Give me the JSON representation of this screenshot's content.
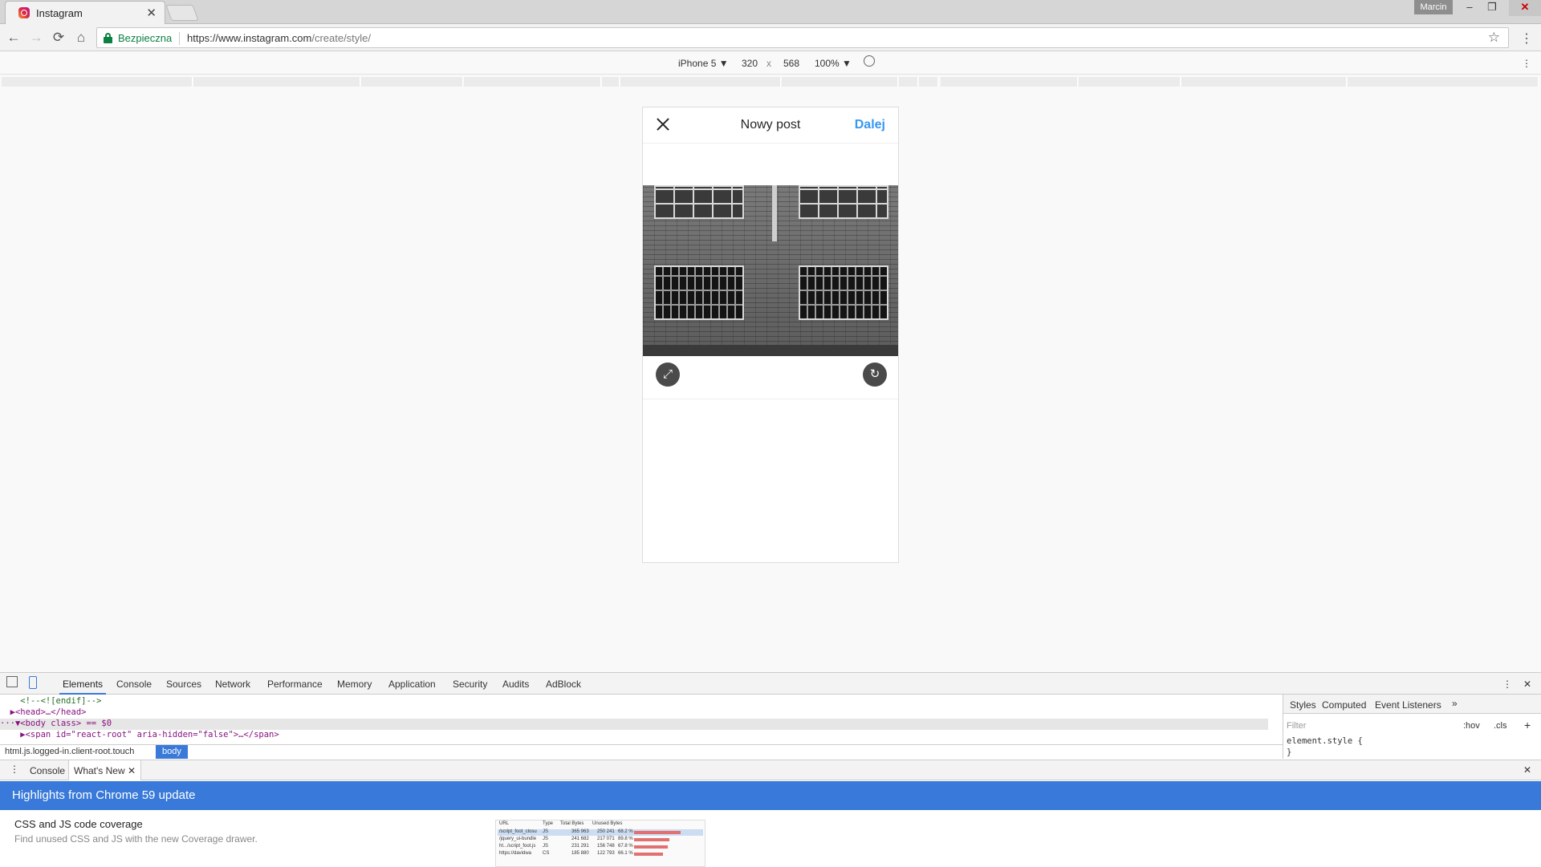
{
  "browser": {
    "tab_title": "Instagram",
    "tab_close": "✕",
    "user_name": "Marcin",
    "win_minimize": "–",
    "win_restore": "❐",
    "win_close": "✕",
    "secure_label": "Bezpieczna",
    "url_host": "https://www.instagram.com",
    "url_path": "/create/style/",
    "back_glyph": "←",
    "forward_glyph": "→",
    "reload_glyph": "⟳",
    "home_glyph": "⌂",
    "star_glyph": "☆",
    "menu_glyph": "⋮"
  },
  "device_toolbar": {
    "device": "iPhone 5 ▼",
    "width": "320",
    "times": "x",
    "height": "568",
    "zoom": "100% ▼",
    "rotate_glyph": "⃠",
    "more_glyph": "⋮"
  },
  "post": {
    "title": "Nowy post",
    "next_label": "Dalej",
    "expand_glyph": "⤢",
    "rotate_glyph": "↻"
  },
  "devtools": {
    "tabs": [
      "Elements",
      "Console",
      "Sources",
      "Network",
      "Performance",
      "Memory",
      "Application",
      "Security",
      "Audits",
      "AdBlock"
    ],
    "code": [
      "    <!--<![endif]-->",
      "  ▶<head>…</head>",
      "···▼<body class> == $0",
      "    ▶<span id=\"react-root\" aria-hidden=\"false\">…</span>"
    ],
    "crumb_path": "html.js.logged-in.client-root.touch",
    "crumb_active": "body",
    "style_tabs": [
      "Styles",
      "Computed",
      "Event Listeners",
      "»"
    ],
    "filter_placeholder": "Filter",
    "hov": ":hov",
    "cls": ".cls",
    "plus": "+",
    "element_style": "element.style {",
    "brace_close": "}",
    "drawer_tabs": [
      "Console",
      "What's New"
    ],
    "drawer_close_tab": "✕",
    "drawer_close": "✕",
    "banner": "Highlights from Chrome 59 update",
    "feature_title": "CSS and JS code coverage",
    "feature_desc": "Find unused CSS and JS with the new Coverage drawer.",
    "coverage_headers": [
      "URL",
      "Type",
      "Total Bytes",
      "Unused Bytes"
    ],
    "coverage_rows": [
      [
        "/script_foot_closu",
        "JS",
        "365 963",
        "250 241",
        "68.2 %"
      ],
      [
        "/jquery_ui-bundle",
        "JS",
        "241 682",
        "217 071",
        "89.8 %"
      ],
      [
        "ht.../script_foot.js",
        "JS",
        "231 291",
        "156 748",
        "67.8 %"
      ],
      [
        "https://davidwa",
        "CS",
        "185 880",
        "122 793",
        "66.1 %"
      ]
    ]
  }
}
